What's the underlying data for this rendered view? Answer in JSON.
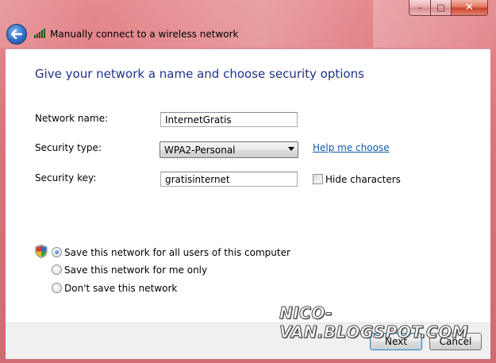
{
  "window": {
    "title": "Manually connect to a wireless network",
    "buttons": {
      "minimize": "–",
      "maximize": "□",
      "close": "✕"
    }
  },
  "heading": "Give your network a name and choose security options",
  "form": {
    "network_name": {
      "label": "Network name:",
      "value": "InternetGratis"
    },
    "security_type": {
      "label": "Security type:",
      "selected": "WPA2-Personal",
      "help_link": "Help me choose"
    },
    "security_key": {
      "label": "Security key:",
      "value": "gratisinternet",
      "hide_characters_label": "Hide characters",
      "hide_characters_checked": false
    }
  },
  "save_options": {
    "all_users": {
      "label": "Save this network for all users of this computer",
      "checked": true
    },
    "me_only": {
      "label": "Save this network for me only",
      "checked": false
    },
    "dont_save": {
      "label": "Don't save this network",
      "checked": false
    }
  },
  "footer": {
    "next_label": "Next",
    "cancel_label": "Cancel"
  },
  "watermark": "NICO-VAN.BLOGSPOT.COM",
  "colors": {
    "heading": "#1e3287",
    "link": "#0f5aa7",
    "frame": "#d9747a"
  }
}
